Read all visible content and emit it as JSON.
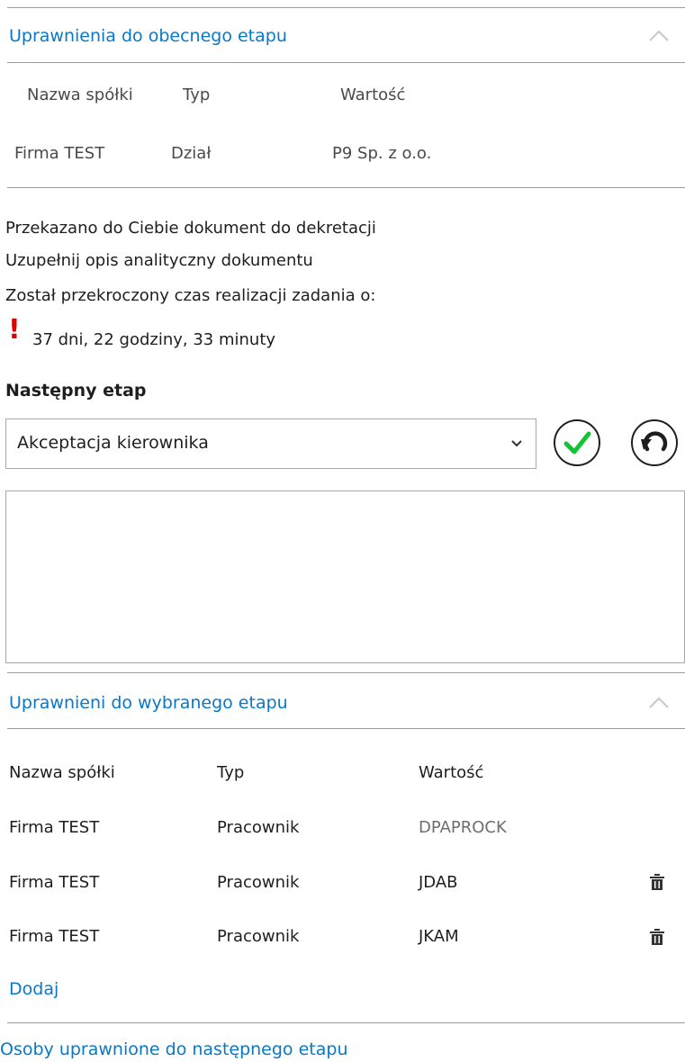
{
  "section1": {
    "title": "Uprawnienia do obecnego etapu",
    "headers": [
      "Nazwa spółki",
      "Typ",
      "Wartość"
    ],
    "rows": [
      {
        "company": "Firma TEST",
        "type": "Dział",
        "value": "P9 Sp. z o.o."
      }
    ]
  },
  "messages": {
    "line1": "Przekazano do Ciebie dokument do dekretacji",
    "line2": "Uzupełnij opis analityczny dokumentu",
    "line3": "Został przekroczony czas realizacji zadania o:",
    "overdue_icon": "!",
    "overdue": "37 dni, 22 godziny, 33 minuty"
  },
  "next_stage": {
    "label": "Następny etap",
    "selected": "Akceptacja kierownika",
    "comment": ""
  },
  "section2": {
    "title": "Uprawnieni do wybranego etapu",
    "headers": [
      "Nazwa spółki",
      "Typ",
      "Wartość"
    ],
    "rows": [
      {
        "company": "Firma TEST",
        "type": "Pracownik",
        "value": "DPAPROCK",
        "deletable": false
      },
      {
        "company": "Firma TEST",
        "type": "Pracownik",
        "value": "JDAB",
        "deletable": true
      },
      {
        "company": "Firma TEST",
        "type": "Pracownik",
        "value": "JKAM",
        "deletable": true
      }
    ],
    "add_label": "Dodaj"
  },
  "section3": {
    "title": "Osoby uprawnione do następnego etapu"
  },
  "colors": {
    "accent": "#0a78c8",
    "confirm_green": "#11c52e",
    "alert_red": "#e10000"
  }
}
